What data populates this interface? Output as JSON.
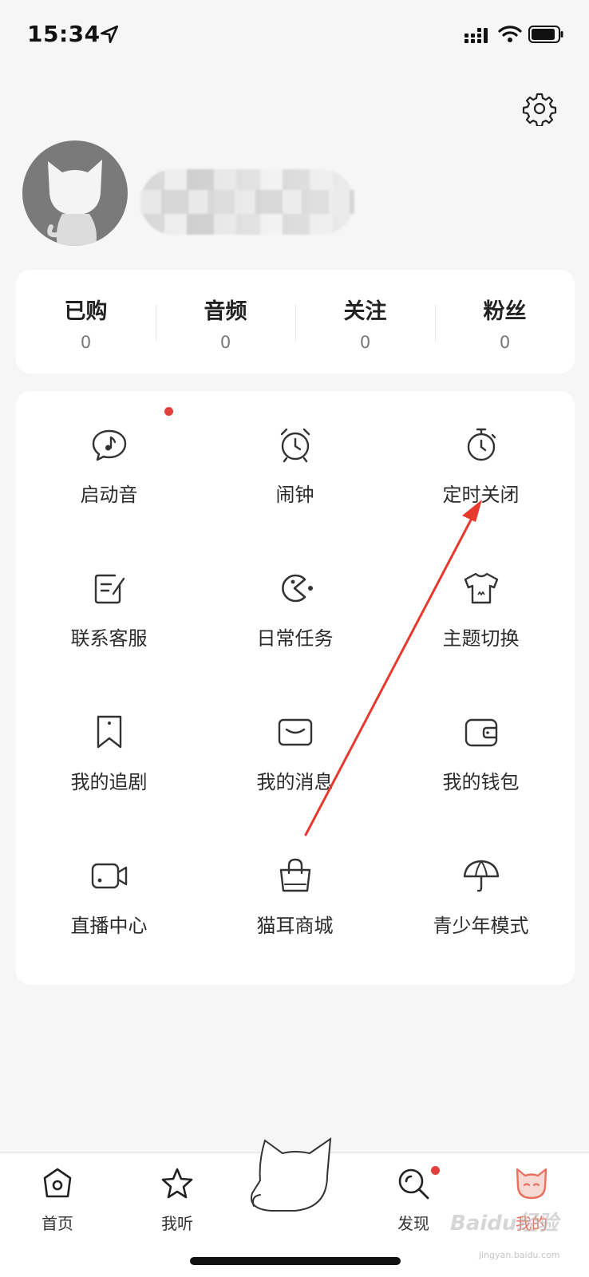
{
  "status_bar": {
    "time": "15:34"
  },
  "stats": [
    {
      "label": "已购",
      "value": "0"
    },
    {
      "label": "音频",
      "value": "0"
    },
    {
      "label": "关注",
      "value": "0"
    },
    {
      "label": "粉丝",
      "value": "0"
    }
  ],
  "menu": [
    {
      "label": "启动音",
      "icon": "chat-music-icon",
      "badge": true
    },
    {
      "label": "闹钟",
      "icon": "alarm-clock-icon"
    },
    {
      "label": "定时关闭",
      "icon": "stopwatch-icon"
    },
    {
      "label": "联系客服",
      "icon": "edit-note-icon"
    },
    {
      "label": "日常任务",
      "icon": "pacman-icon"
    },
    {
      "label": "主题切换",
      "icon": "tshirt-icon"
    },
    {
      "label": "我的追剧",
      "icon": "bookmark-icon"
    },
    {
      "label": "我的消息",
      "icon": "envelope-icon"
    },
    {
      "label": "我的钱包",
      "icon": "wallet-icon"
    },
    {
      "label": "直播中心",
      "icon": "video-camera-icon"
    },
    {
      "label": "猫耳商城",
      "icon": "shopping-bag-icon"
    },
    {
      "label": "青少年模式",
      "icon": "umbrella-icon"
    }
  ],
  "tabs": [
    {
      "label": "首页",
      "icon": "home-icon"
    },
    {
      "label": "我听",
      "icon": "star-icon"
    },
    {
      "label": "发现",
      "icon": "discover-search-icon",
      "badge": true
    },
    {
      "label": "我的",
      "icon": "cat-face-icon",
      "active": true
    }
  ],
  "watermark": {
    "text": "Baidu经验",
    "sub": "jingyan.baidu.com"
  },
  "colors": {
    "accent": "#e9705e",
    "badge": "#e2403a",
    "annotation_arrow": "#e8392f",
    "background": "#f7f6f7"
  }
}
